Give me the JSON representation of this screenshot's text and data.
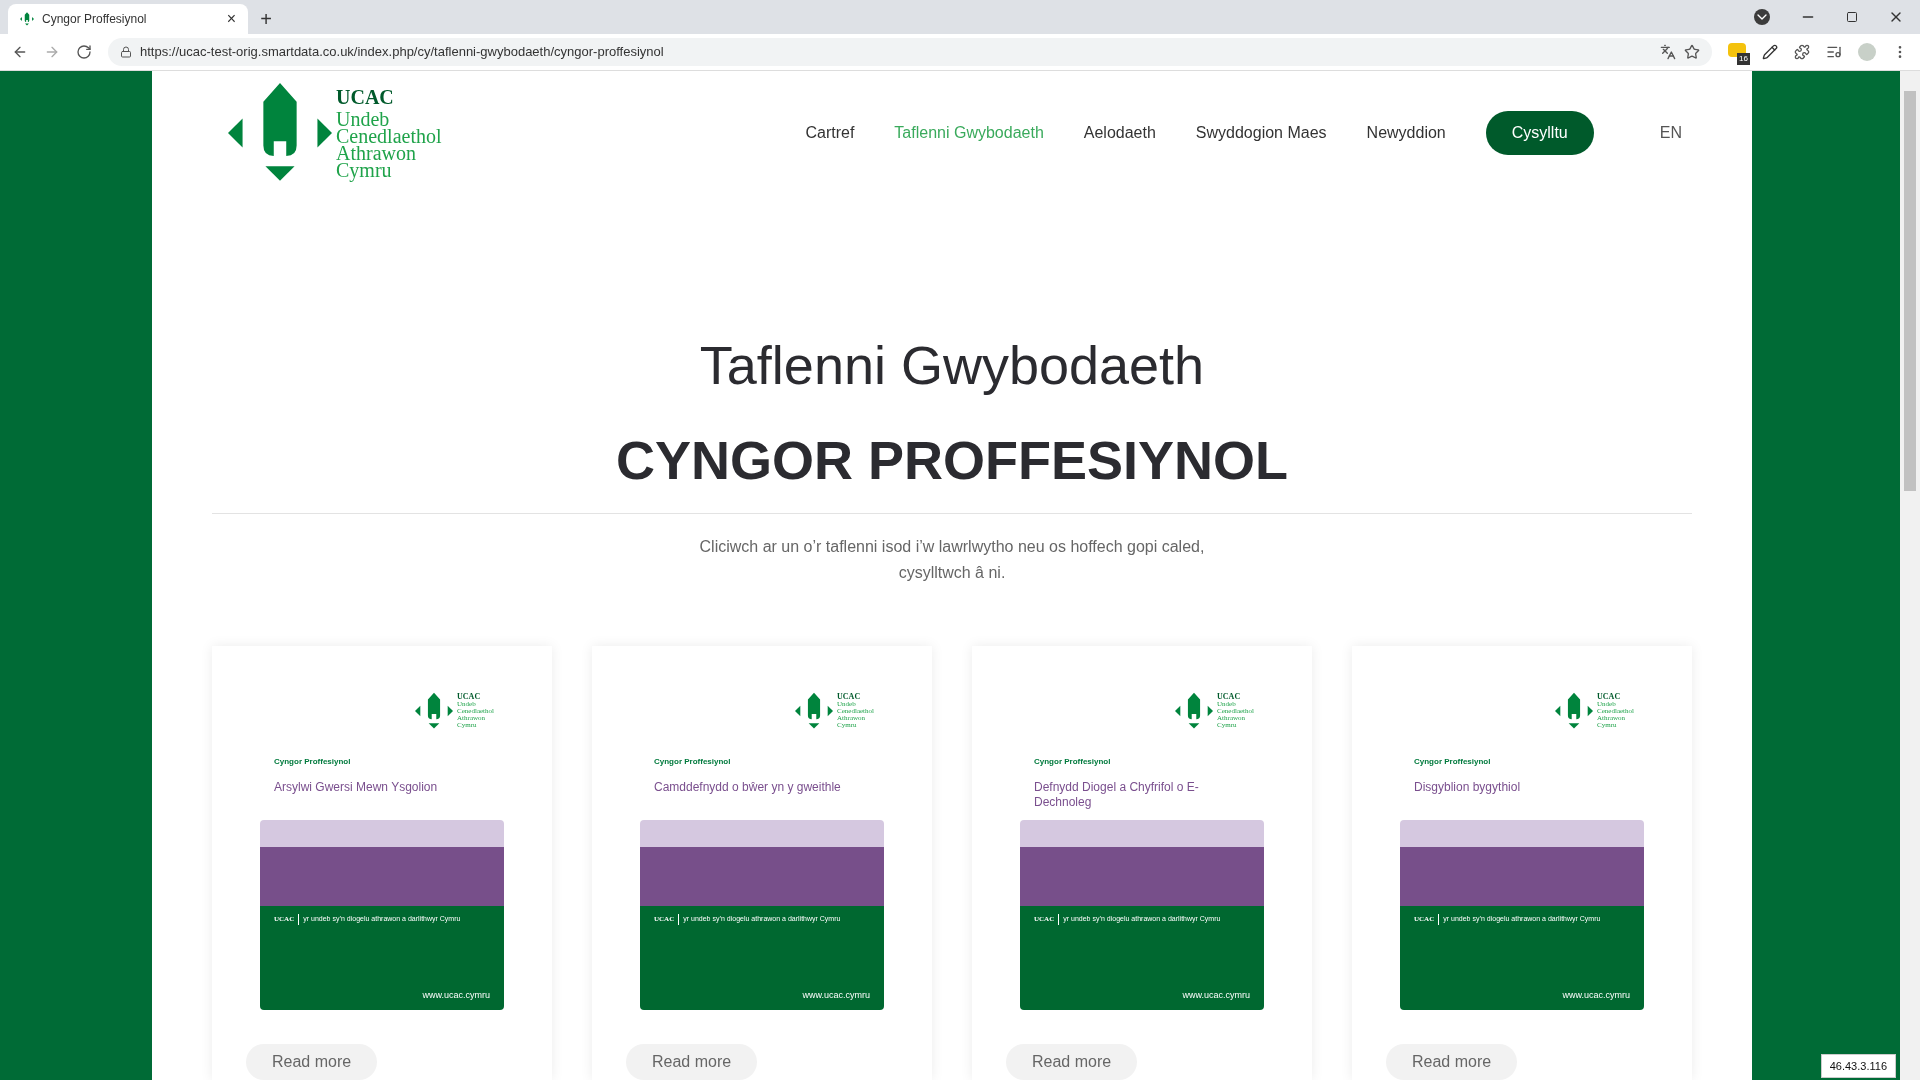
{
  "browser": {
    "tab": {
      "title": "Cyngor Proffesiynol",
      "close": "×"
    },
    "new_tab": "+",
    "url": "https://ucac-test-orig.smartdata.co.uk/index.php/cy/taflenni-gwybodaeth/cyngor-proffesiynol",
    "extension_badge": "16"
  },
  "header": {
    "logo": {
      "abbr": "UCAC",
      "lines": [
        "Undeb",
        "Cenedlaethol",
        "Athrawon",
        "Cymru"
      ]
    },
    "nav": [
      {
        "label": "Cartref",
        "selected": false
      },
      {
        "label": "Taflenni Gwybodaeth",
        "selected": true
      },
      {
        "label": "Aelodaeth",
        "selected": false
      },
      {
        "label": "Swyddogion Maes",
        "selected": false
      },
      {
        "label": "Newyddion",
        "selected": false
      }
    ],
    "contact_button": "Cysylltu",
    "language": "EN"
  },
  "hero": {
    "title": "Taflenni Gwybodaeth",
    "heading": "CYNGOR PROFFESIYNOL",
    "intro": "Cliciwch ar un o’r taflenni isod i’w lawrlwytho neu os hoffech gopi caled, cysylltwch â ni."
  },
  "cards": [
    {
      "series": "Cyngor Proffesiynol",
      "title": "Arsylwi Gwersi Mewn Ysgolion",
      "brand": "UCAC",
      "tagline": "yr undeb sy’n diogelu athrawon a darlithwyr Cymru",
      "website": "www.ucac.cymru",
      "logo": {
        "abbr": "UCAC",
        "lines": [
          "Undeb",
          "Cenedlaethol",
          "Athrawon",
          "Cymru"
        ]
      },
      "button": "Read more"
    },
    {
      "series": "Cyngor Proffesiynol",
      "title": "Camddefnydd o bŵer yn y gweithle",
      "brand": "UCAC",
      "tagline": "yr undeb sy’n diogelu athrawon a darlithwyr Cymru",
      "website": "www.ucac.cymru",
      "logo": {
        "abbr": "UCAC",
        "lines": [
          "Undeb",
          "Cenedlaethol",
          "Athrawon",
          "Cymru"
        ]
      },
      "button": "Read more"
    },
    {
      "series": "Cyngor Proffesiynol",
      "title": "Defnydd Diogel a Chyfrifol o E-Dechnoleg",
      "brand": "UCAC",
      "tagline": "yr undeb sy’n diogelu athrawon a darlithwyr Cymru",
      "website": "www.ucac.cymru",
      "logo": {
        "abbr": "UCAC",
        "lines": [
          "Undeb",
          "Cenedlaethol",
          "Athrawon",
          "Cymru"
        ]
      },
      "button": "Read more"
    },
    {
      "series": "Cyngor Proffesiynol",
      "title": "Disgyblion bygythiol",
      "brand": "UCAC",
      "tagline": "yr undeb sy’n diogelu athrawon a darlithwyr Cymru",
      "website": "www.ucac.cymru",
      "logo": {
        "abbr": "UCAC",
        "lines": [
          "Undeb",
          "Cenedlaethol",
          "Athrawon",
          "Cymru"
        ]
      },
      "button": "Read more"
    }
  ],
  "ip_badge": "46.43.3.116"
}
